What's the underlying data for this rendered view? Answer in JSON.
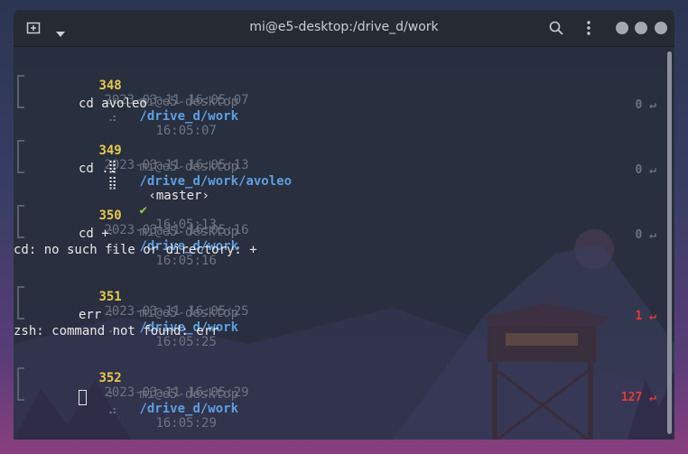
{
  "window": {
    "title": "mi@e5-desktop:/drive_d/work"
  },
  "entries": [
    {
      "number": "348",
      "datetime": "2023-03-11 16:05:07",
      "user_host": "mi@e5-desktop",
      "path": "/drive_d/work",
      "git": "",
      "check": "",
      "time": "16:05:07",
      "command": "cd avoleo",
      "exit_code": "0",
      "output": ""
    },
    {
      "number": "349",
      "datetime": "2023-03-11 16:05:13",
      "user_host": "mi@e5-desktop",
      "path": "/drive_d/work/avoleo",
      "git": "‹master›",
      "check": "✔",
      "time": "16:05:13",
      "command": "cd ..",
      "exit_code": "0",
      "output": ""
    },
    {
      "number": "350",
      "datetime": "2023-03-11 16:05:16",
      "user_host": "mi@e5-desktop",
      "path": "/drive_d/work",
      "git": "",
      "check": "",
      "time": "16:05:16",
      "command": "cd +",
      "exit_code": "0",
      "output": "cd: no such file or directory: +"
    },
    {
      "number": "351",
      "datetime": "2023-03-11 16:05:25",
      "user_host": "mi@e5-desktop",
      "path": "/drive_d/work",
      "git": "",
      "check": "",
      "time": "16:05:25",
      "command": "err",
      "exit_code": "1",
      "output": "zsh: command not found: err"
    },
    {
      "number": "352",
      "datetime": "2023-03-11 16:05:29",
      "user_host": "mi@e5-desktop",
      "path": "/drive_d/work",
      "git": "",
      "check": "",
      "time": "16:05:29",
      "command": "",
      "exit_code": "127",
      "output": ""
    }
  ],
  "return_symbol": "↵",
  "colors": {
    "error": "#e53935",
    "number": "#e6c84a",
    "path": "#5e9fe0",
    "check": "#8ed042"
  }
}
